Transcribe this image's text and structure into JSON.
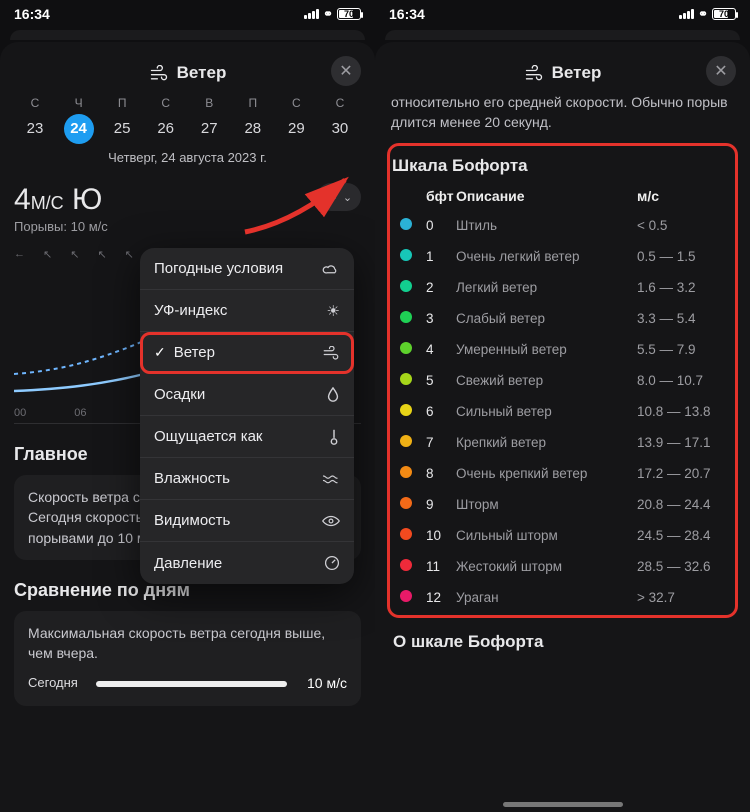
{
  "status": {
    "time": "16:34",
    "battery": "70"
  },
  "header": {
    "title": "Ветер"
  },
  "days": [
    {
      "dw": "С",
      "num": "23"
    },
    {
      "dw": "Ч",
      "num": "24",
      "selected": true
    },
    {
      "dw": "П",
      "num": "25"
    },
    {
      "dw": "С",
      "num": "26"
    },
    {
      "dw": "В",
      "num": "27"
    },
    {
      "dw": "П",
      "num": "28"
    },
    {
      "dw": "С",
      "num": "29"
    },
    {
      "dw": "С",
      "num": "30"
    }
  ],
  "date_full": "Четверг, 24 августа 2023 г.",
  "reading": {
    "value": "4",
    "unit": "М/С",
    "dir": "Ю",
    "gust_label": "Порывы: 10 м/с"
  },
  "chart": {
    "xlabels": [
      "00",
      "06"
    ]
  },
  "dropdown": [
    {
      "label": "Погодные условия",
      "icon": "cloud"
    },
    {
      "label": "УФ-индекс",
      "icon": "sun"
    },
    {
      "label": "Ветер",
      "icon": "wind",
      "selected": true
    },
    {
      "label": "Осадки",
      "icon": "drop"
    },
    {
      "label": "Ощущается как",
      "icon": "therm"
    },
    {
      "label": "Влажность",
      "icon": "waves"
    },
    {
      "label": "Видимость",
      "icon": "eye"
    },
    {
      "label": "Давление",
      "icon": "gauge"
    }
  ],
  "main_section": {
    "title": "Главное",
    "text": "Скорость ветра сейчас 4 м/с, направление: юг. Сегодня скорость ветра составит от 2 до 5 м/с с порывами до 10 м/с."
  },
  "compare": {
    "title": "Сравнение по дням",
    "text": "Максимальная скорость ветра сегодня выше, чем вчера.",
    "today_label": "Сегодня",
    "today_value": "10 м/с"
  },
  "right": {
    "info_text": "относительно его средней скорости. Обычно порыв длится менее 20 секунд.",
    "beaufort_title": "Шкала Бофорта",
    "cols": {
      "bft": "бфт",
      "desc": "Описание",
      "ms": "м/с"
    },
    "rows": [
      {
        "n": "0",
        "desc": "Штиль",
        "ms": "< 0.5",
        "c": "#2bb1d6"
      },
      {
        "n": "1",
        "desc": "Очень легкий ветер",
        "ms": "0.5 — 1.5",
        "c": "#17c6b7"
      },
      {
        "n": "2",
        "desc": "Легкий ветер",
        "ms": "1.6 — 3.2",
        "c": "#12cf8f"
      },
      {
        "n": "3",
        "desc": "Слабый ветер",
        "ms": "3.3 — 5.4",
        "c": "#1fd155"
      },
      {
        "n": "4",
        "desc": "Умеренный ветер",
        "ms": "5.5 — 7.9",
        "c": "#5ed12c"
      },
      {
        "n": "5",
        "desc": "Свежий ветер",
        "ms": "8.0 — 10.7",
        "c": "#a6d61a"
      },
      {
        "n": "6",
        "desc": "Сильный ветер",
        "ms": "10.8 — 13.8",
        "c": "#e7d317"
      },
      {
        "n": "7",
        "desc": "Крепкий ветер",
        "ms": "13.9 — 17.1",
        "c": "#efb015"
      },
      {
        "n": "8",
        "desc": "Очень крепкий ветер",
        "ms": "17.2 — 20.7",
        "c": "#f28a14"
      },
      {
        "n": "9",
        "desc": "Шторм",
        "ms": "20.8 — 24.4",
        "c": "#f26a18"
      },
      {
        "n": "10",
        "desc": "Сильный шторм",
        "ms": "24.5 — 28.4",
        "c": "#f24a1f"
      },
      {
        "n": "11",
        "desc": "Жестокий шторм",
        "ms": "28.5 — 32.6",
        "c": "#ef2a3a"
      },
      {
        "n": "12",
        "desc": "Ураган",
        "ms": "> 32.7",
        "c": "#e81a68"
      }
    ],
    "about": "О шкале Бофорта"
  }
}
